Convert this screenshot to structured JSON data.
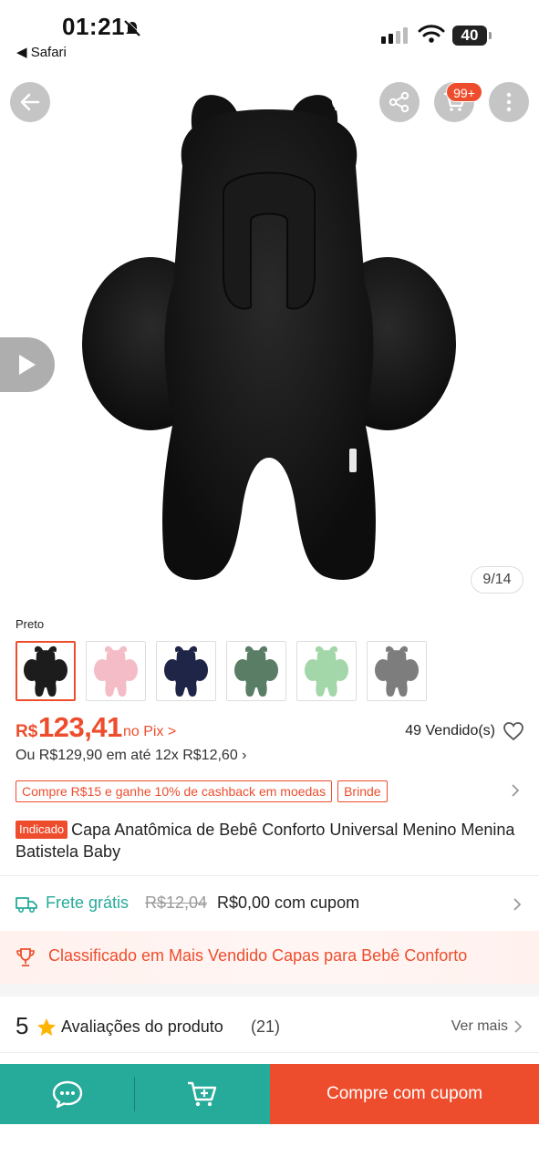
{
  "status_bar": {
    "time": "01:21",
    "back_app": "◀ Safari",
    "battery": "40"
  },
  "hero": {
    "image_counter": "9/14",
    "cart_badge": "99+",
    "icons": [
      "back-arrow-icon",
      "whatsapp-share-icon",
      "share-icon",
      "cart-icon",
      "more-vertical-icon",
      "play-icon"
    ]
  },
  "variations": {
    "selected_label": "Preto",
    "swatches": [
      {
        "color": "#1c1c1c"
      },
      {
        "color": "#f4bcc6"
      },
      {
        "color": "#1f2547"
      },
      {
        "color": "#5a7d66"
      },
      {
        "color": "#a3d6a9"
      },
      {
        "color": "#7d7d7d"
      }
    ]
  },
  "price": {
    "currency": "R$",
    "value": "123,41",
    "pix_label": "no Pix >",
    "sold": "49 Vendido(s)",
    "installments": "Ou R$129,90 em até 12x R$12,60 ›"
  },
  "promo_tags": [
    "Compre R$15 e ganhe 10% de cashback em moedas",
    "Brinde"
  ],
  "product": {
    "badge": "Indicado",
    "title": "Capa Anatômica de Bebê Conforto Universal Menino Menina Batistela Baby"
  },
  "shipping": {
    "label": "Frete grátis",
    "old_price": "R$12,04",
    "new_price": "R$0,00 com cupom"
  },
  "ranking": {
    "text": "Classificado em Mais Vendido Capas para Bebê Conforto"
  },
  "reviews": {
    "rating": "5",
    "title": "Avaliações do produto",
    "count": "(21)",
    "see_more": "Ver mais"
  },
  "bottom_bar": {
    "buy_label": "Compre com cupom"
  },
  "colors": {
    "accent": "#ee4d2d",
    "teal": "#26aa99"
  }
}
